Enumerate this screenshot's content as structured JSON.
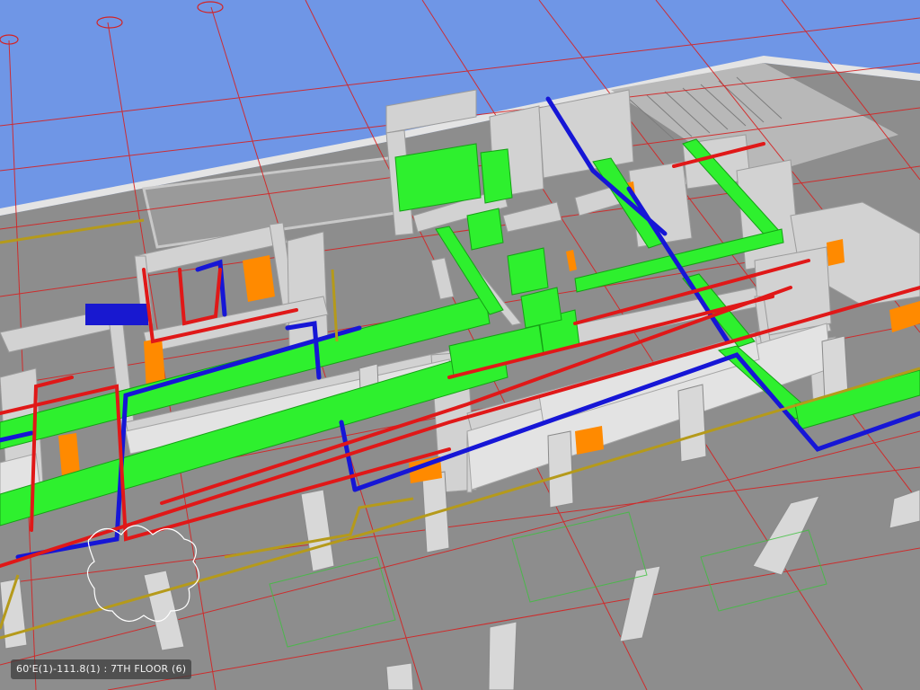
{
  "viewer": {
    "status_label": "60'E(1)-111.8(1) : 7TH FLOOR (6)"
  },
  "colors": {
    "sky": "#6f96e6",
    "slab": "#8c8c8c",
    "wall": "#cfcfcf",
    "wall_top": "#e8e8e8",
    "grid_line": "#d02020",
    "duct_green": "#22ee22",
    "pipe_blue": "#1a1ad8",
    "pipe_red": "#e31515",
    "pipe_orange": "#ff8a00",
    "pipe_gold": "#b59a1b"
  },
  "icons": [
    "gridline-bubble-icon"
  ]
}
